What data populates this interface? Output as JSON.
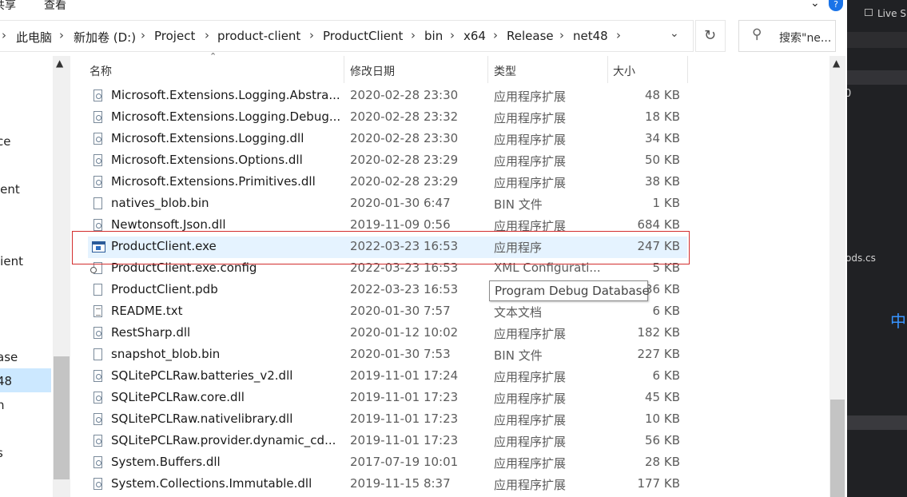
{
  "ribbon": {
    "share_tab": "共享",
    "view_tab": "查看"
  },
  "breadcrumb": [
    "此电脑",
    "新加卷 (D:)",
    "Project",
    "product-client",
    "ProductClient",
    "bin",
    "x64",
    "Release",
    "net48"
  ],
  "search": {
    "placeholder": "搜索\"ne..."
  },
  "nav_pane": [
    "ce",
    "ient",
    "lient",
    "ase",
    "48",
    "n",
    "s"
  ],
  "columns": {
    "name": "名称",
    "date": "修改日期",
    "type": "类型",
    "size": "大小"
  },
  "files": [
    {
      "name": "Microsoft.Extensions.Logging.Abstra...",
      "date": "2020-02-28 23:30",
      "type": "应用程序扩展",
      "size": "48 KB",
      "icon": "dll-icon"
    },
    {
      "name": "Microsoft.Extensions.Logging.Debug...",
      "date": "2020-02-28 23:32",
      "type": "应用程序扩展",
      "size": "18 KB",
      "icon": "dll-icon"
    },
    {
      "name": "Microsoft.Extensions.Logging.dll",
      "date": "2020-02-28 23:30",
      "type": "应用程序扩展",
      "size": "34 KB",
      "icon": "dll-icon"
    },
    {
      "name": "Microsoft.Extensions.Options.dll",
      "date": "2020-02-28 23:29",
      "type": "应用程序扩展",
      "size": "50 KB",
      "icon": "dll-icon"
    },
    {
      "name": "Microsoft.Extensions.Primitives.dll",
      "date": "2020-02-28 23:29",
      "type": "应用程序扩展",
      "size": "38 KB",
      "icon": "dll-icon"
    },
    {
      "name": "natives_blob.bin",
      "date": "2020-01-30 6:47",
      "type": "BIN 文件",
      "size": "1 KB",
      "icon": "file-icon"
    },
    {
      "name": "Newtonsoft.Json.dll",
      "date": "2019-11-09 0:56",
      "type": "应用程序扩展",
      "size": "684 KB",
      "icon": "dll-icon"
    },
    {
      "name": "ProductClient.exe",
      "date": "2022-03-23 16:53",
      "type": "应用程序",
      "size": "247 KB",
      "icon": "exe-icon"
    },
    {
      "name": "ProductClient.exe.config",
      "date": "2022-03-23 16:53",
      "type": "XML Configurati...",
      "size": "5 KB",
      "icon": "config-icon"
    },
    {
      "name": "ProductClient.pdb",
      "date": "2022-03-23 16:53",
      "type": "Program Debug Database",
      "size": "36 KB",
      "icon": "file-icon"
    },
    {
      "name": "README.txt",
      "date": "2020-01-30 7:57",
      "type": "文本文档",
      "size": "6 KB",
      "icon": "text-file-icon"
    },
    {
      "name": "RestSharp.dll",
      "date": "2020-01-12 10:02",
      "type": "应用程序扩展",
      "size": "182 KB",
      "icon": "dll-icon"
    },
    {
      "name": "snapshot_blob.bin",
      "date": "2020-01-30 7:53",
      "type": "BIN 文件",
      "size": "227 KB",
      "icon": "file-icon"
    },
    {
      "name": "SQLitePCLRaw.batteries_v2.dll",
      "date": "2019-11-01 17:24",
      "type": "应用程序扩展",
      "size": "6 KB",
      "icon": "dll-icon"
    },
    {
      "name": "SQLitePCLRaw.core.dll",
      "date": "2019-11-01 17:23",
      "type": "应用程序扩展",
      "size": "45 KB",
      "icon": "dll-icon"
    },
    {
      "name": "SQLitePCLRaw.nativelibrary.dll",
      "date": "2019-11-01 17:23",
      "type": "应用程序扩展",
      "size": "10 KB",
      "icon": "dll-icon"
    },
    {
      "name": "SQLitePCLRaw.provider.dynamic_cd...",
      "date": "2019-11-01 17:23",
      "type": "应用程序扩展",
      "size": "56 KB",
      "icon": "dll-icon"
    },
    {
      "name": "System.Buffers.dll",
      "date": "2017-07-19 10:01",
      "type": "应用程序扩展",
      "size": "28 KB",
      "icon": "dll-icon"
    },
    {
      "name": "System.Collections.Immutable.dll",
      "date": "2019-11-15 8:37",
      "type": "应用程序扩展",
      "size": "177 KB",
      "icon": "dll-icon"
    }
  ],
  "selected_file": "ProductClient.exe",
  "tooltip": "Program Debug Database",
  "side_app": {
    "live_share": "Live Sh",
    "zero": "0",
    "filename": "ods.cs",
    "ime_indicator": "中"
  },
  "colors": {
    "selection": "#e5f3ff",
    "highlight_box": "#d22d2d",
    "dark_panel": "#202124"
  }
}
